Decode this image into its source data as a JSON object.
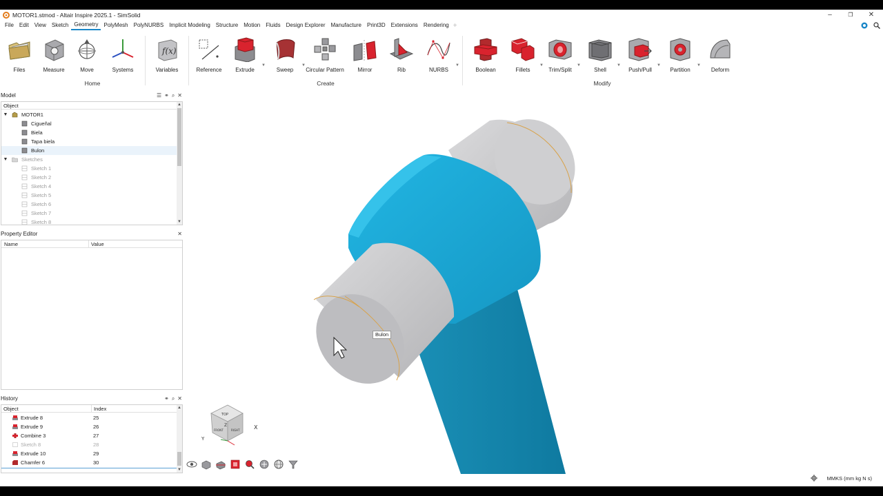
{
  "window": {
    "title": "MOTOR1.stmod - Altair Inspire 2025.1 - SimSolid",
    "controls": [
      "–",
      "❐",
      "✕"
    ]
  },
  "menu": {
    "items": [
      "File",
      "Edit",
      "View",
      "Sketch",
      "Geometry",
      "PolyMesh",
      "PolyNURBS",
      "Implicit Modeling",
      "Structure",
      "Motion",
      "Fluids",
      "Design Explorer",
      "Manufacture",
      "Print3D",
      "Extensions",
      "Rendering"
    ],
    "active": "Geometry",
    "plus": "+"
  },
  "ribbon": {
    "home": {
      "group_label": "Home",
      "buttons": [
        "Files",
        "Measure",
        "Move",
        "Systems",
        "Variables"
      ]
    },
    "create": {
      "group_label": "Create",
      "buttons": [
        "Reference",
        "Extrude",
        "Sweep",
        "Circular Pattern",
        "Mirror",
        "Rib",
        "NURBS"
      ]
    },
    "modify": {
      "group_label": "Modify",
      "buttons": [
        "Boolean",
        "Fillets",
        "Trim/Split",
        "Shell",
        "Push/Pull",
        "Partition",
        "Deform"
      ]
    }
  },
  "model_panel": {
    "title": "Model",
    "column": "Object",
    "root": "MOTOR1",
    "parts": [
      "Cigueñal",
      "Biela",
      "Tapa biela",
      "Bulon"
    ],
    "selected": "Bulon",
    "sketches_folder": "Sketches",
    "sketches": [
      "Sketch 1",
      "Sketch 2",
      "Sketch 4",
      "Sketch 5",
      "Sketch 6",
      "Sketch 7",
      "Sketch 8"
    ]
  },
  "property_panel": {
    "title": "Property Editor",
    "columns": [
      "Name",
      "Value"
    ]
  },
  "history_panel": {
    "title": "History",
    "columns": [
      "Object",
      "Index"
    ],
    "rows": [
      {
        "name": "Extrude 8",
        "index": "25"
      },
      {
        "name": "Extrude 9",
        "index": "26"
      },
      {
        "name": "Combine 3",
        "index": "27"
      },
      {
        "name": "Sketch 8",
        "index": "28"
      },
      {
        "name": "Extrude 10",
        "index": "29"
      },
      {
        "name": "Chamfer 6",
        "index": "30"
      }
    ]
  },
  "viewport": {
    "tooltip": "Bulon",
    "view_cube": {
      "top": "TOP",
      "front": "FRONT",
      "right": "RIGHT"
    },
    "axes": {
      "x": "X",
      "y": "Y",
      "z": "Z"
    }
  },
  "status": {
    "units": "MMKS (mm kg N s)"
  },
  "colors": {
    "accent": "#1a87c8",
    "part_blue": "#17a7d3",
    "part_gray": "#c9c9cb",
    "ribbon_red": "#d9232e"
  }
}
